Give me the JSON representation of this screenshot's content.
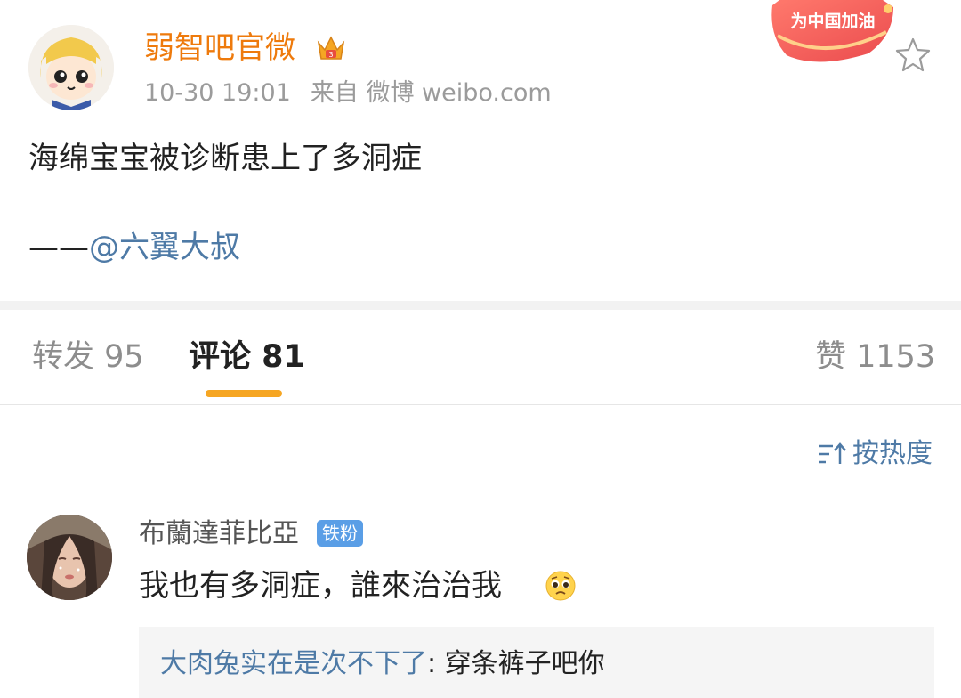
{
  "post": {
    "username": "弱智吧官微",
    "timestamp": "10-30 19:01",
    "source": "来自 微博 weibo.com",
    "text": "海绵宝宝被诊断患上了多洞症",
    "credit_prefix": "——",
    "credit_mention": "@六翼大叔",
    "cheer_badge": "为中国加油",
    "icons": {
      "crown": "crown-icon",
      "favorite": "star-outline-icon"
    },
    "accent_color": "#ee7a0c"
  },
  "tabs": {
    "repost": "转发 95",
    "comments": "评论 81",
    "likes": "赞 1153",
    "active": "comments",
    "underline_color": "#f6a623"
  },
  "sort": {
    "label": "按热度",
    "icon": "sort-icon"
  },
  "comment": {
    "author": "布蘭達菲比亞",
    "badge": "铁粉",
    "text": "我也有多洞症，誰來治治我",
    "emoji": "pleading-face-icon",
    "reply": {
      "author": "大肉兔实在是次不下了",
      "separator": ": ",
      "text": "穿条裤子吧你"
    }
  },
  "link_color": "#4e7aa6"
}
